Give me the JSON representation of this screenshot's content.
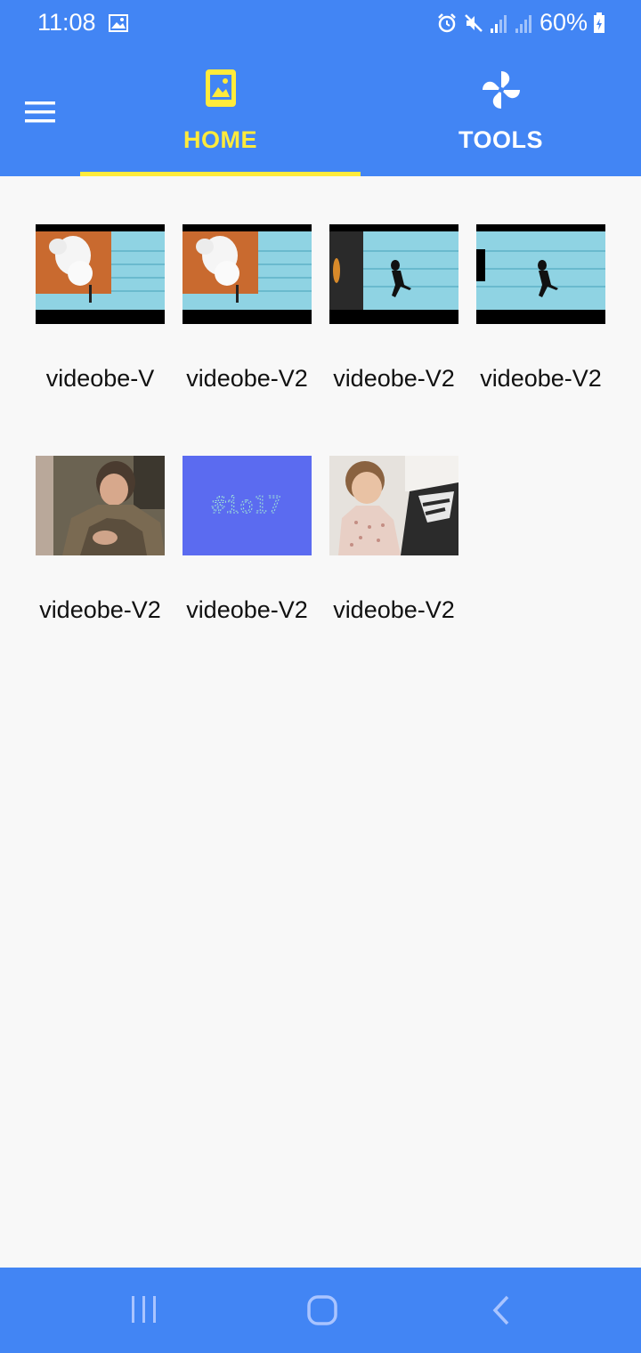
{
  "status": {
    "time": "11:08",
    "battery": "60%"
  },
  "tabs": [
    {
      "label": "HOME",
      "icon": "image-icon",
      "selected": true,
      "color": "#ffeb3b"
    },
    {
      "label": "TOOLS",
      "icon": "pinwheel-icon",
      "selected": false,
      "color": "#ffffff"
    }
  ],
  "videos": [
    {
      "title": "videobe-V",
      "thumbnail": "cat-water"
    },
    {
      "title": "videobe-V2",
      "thumbnail": "cat-water"
    },
    {
      "title": "videobe-V2",
      "thumbnail": "man-lamp-water"
    },
    {
      "title": "videobe-V2",
      "thumbnail": "man-water"
    },
    {
      "title": "videobe-V2",
      "thumbnail": "woman-fur-coat"
    },
    {
      "title": "videobe-V2",
      "thumbnail": "io17-text",
      "thumbnail_text": "#io17"
    },
    {
      "title": "videobe-V2",
      "thumbnail": "child-sofa"
    }
  ],
  "colors": {
    "primary": "#4285f4",
    "accent": "#ffeb3b",
    "background": "#f8f8f8"
  }
}
